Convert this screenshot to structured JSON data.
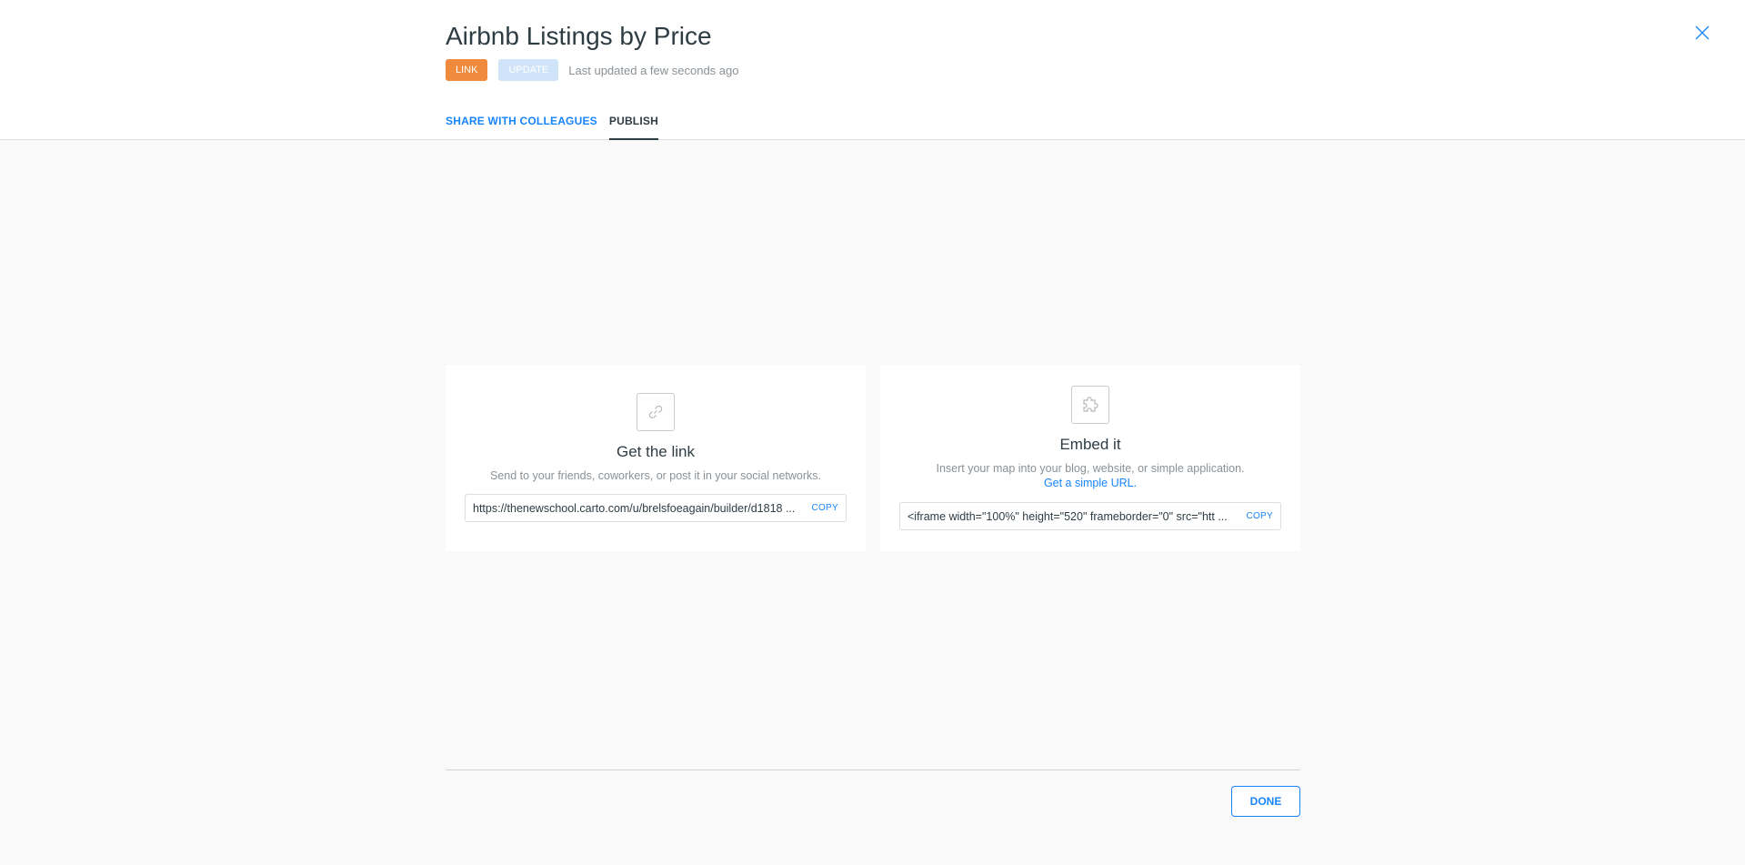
{
  "header": {
    "title": "Airbnb Listings by Price",
    "badges": {
      "link_label": "LINK",
      "update_label": "UPDATE"
    },
    "last_updated": "Last updated a few seconds ago",
    "close_icon": "close-icon"
  },
  "tabs": [
    {
      "label": "SHARE WITH COLLEAGUES",
      "active": false
    },
    {
      "label": "PUBLISH",
      "active": true
    }
  ],
  "cards": {
    "link": {
      "icon": "link-icon",
      "title": "Get the link",
      "description": "Send to your friends, coworkers, or post it in your social networks.",
      "value": "https://thenewschool.carto.com/u/brelsfoeagain/builder/d1818 ...",
      "copy_label": "COPY"
    },
    "embed": {
      "icon": "puzzle-icon",
      "title": "Embed it",
      "description": "Insert your map into your blog, website, or simple application.",
      "sub_link": "Get a simple URL.",
      "value": "<iframe width=\"100%\" height=\"520\" frameborder=\"0\" src=\"htt ...",
      "copy_label": "COPY"
    }
  },
  "footer": {
    "done_label": "DONE"
  },
  "colors": {
    "accent": "#1785fb",
    "link_badge": "#f08a3c",
    "update_badge": "#cfe4f9",
    "background": "#f9f9f9",
    "text": "#2e3c43",
    "muted": "#8a9196"
  }
}
